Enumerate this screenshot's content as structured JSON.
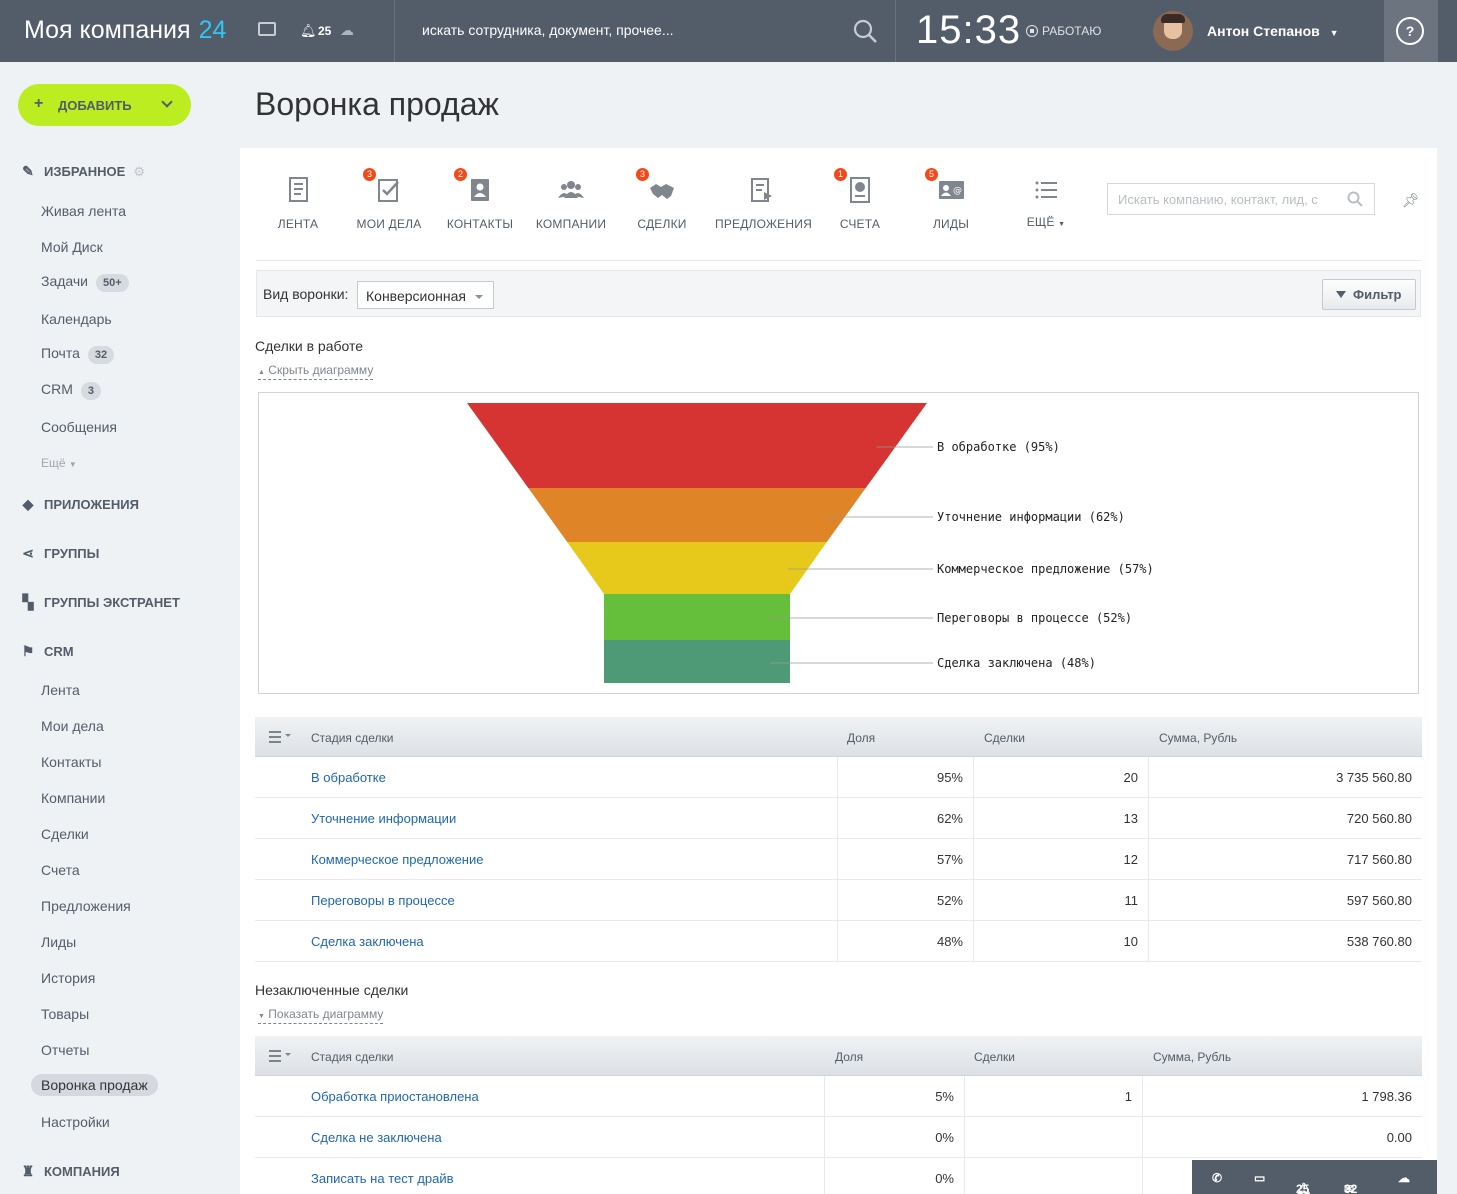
{
  "topbar": {
    "logo_text": "Моя компания",
    "logo_number": "24",
    "notifications_count": "25",
    "search_placeholder": "искать сотрудника, документ, прочее...",
    "clock": "15:33",
    "work_status": "РАБОТАЮ",
    "user_name": "Антон Степанов",
    "help_label": "?"
  },
  "sidebar": {
    "add_button": "ДОБАВИТЬ",
    "favorites_label": "ИЗБРАННОЕ",
    "favorites": [
      {
        "label": "Живая лента"
      },
      {
        "label": "Мой Диск"
      },
      {
        "label": "Задачи",
        "badge": "50+"
      },
      {
        "label": "Календарь"
      },
      {
        "label": "Почта",
        "badge": "32"
      },
      {
        "label": "CRM",
        "badge": "3"
      },
      {
        "label": "Сообщения"
      }
    ],
    "more_label": "Ещё",
    "sections": {
      "apps": "ПРИЛОЖЕНИЯ",
      "groups": "ГРУППЫ",
      "extranet": "ГРУППЫ ЭКСТРАНЕТ",
      "crm": "CRM",
      "company": "КОМПАНИЯ"
    },
    "crm_items": [
      {
        "label": "Лента"
      },
      {
        "label": "Мои дела"
      },
      {
        "label": "Контакты"
      },
      {
        "label": "Компании"
      },
      {
        "label": "Сделки"
      },
      {
        "label": "Счета"
      },
      {
        "label": "Предложения"
      },
      {
        "label": "Лиды"
      },
      {
        "label": "История"
      },
      {
        "label": "Товары"
      },
      {
        "label": "Отчеты"
      },
      {
        "label": "Воронка продаж",
        "active": true
      },
      {
        "label": "Настройки"
      }
    ]
  },
  "page_title": "Воронка продаж",
  "crm_nav": [
    {
      "label": "ЛЕНТА",
      "icon": "feed-icon",
      "counter": ""
    },
    {
      "label": "МОИ ДЕЛА",
      "icon": "tasks-icon",
      "counter": "3"
    },
    {
      "label": "КОНТАКТЫ",
      "icon": "contacts-icon",
      "counter": "2"
    },
    {
      "label": "КОМПАНИИ",
      "icon": "companies-icon",
      "counter": ""
    },
    {
      "label": "СДЕЛКИ",
      "icon": "deals-icon",
      "counter": "3"
    },
    {
      "label": "ПРЕДЛОЖЕНИЯ",
      "icon": "quotes-icon",
      "counter": ""
    },
    {
      "label": "СЧЕТА",
      "icon": "invoices-icon",
      "counter": "1"
    },
    {
      "label": "ЛИДЫ",
      "icon": "leads-icon",
      "counter": "5"
    },
    {
      "label": "ЕЩЁ",
      "icon": "more-icon",
      "counter": ""
    }
  ],
  "crm_search_placeholder": "Искать компанию, контакт, лид, с",
  "funnel_view": {
    "label": "Вид воронки:",
    "value": "Конверсионная",
    "filter_label": "Фильтр"
  },
  "deals_in_work": {
    "title": "Сделки в работе",
    "toggle": "Скрыть диаграмму"
  },
  "chart_data": {
    "type": "funnel",
    "stages": [
      {
        "name": "В обработке",
        "percent": 95,
        "label": "В обработке (95%)",
        "color": "#d63333"
      },
      {
        "name": "Уточнение информации",
        "percent": 62,
        "label": "Уточнение информации (62%)",
        "color": "#df8427"
      },
      {
        "name": "Коммерческое предложение",
        "percent": 57,
        "label": "Коммерческое предложение (57%)",
        "color": "#e6c91b"
      },
      {
        "name": "Переговоры в процессе",
        "percent": 52,
        "label": "Переговоры в процессе (52%)",
        "color": "#66bf3a"
      },
      {
        "name": "Сделка заключена",
        "percent": 48,
        "label": "Сделка заключена (48%)",
        "color": "#4f9a76"
      }
    ]
  },
  "table_headers": {
    "stage": "Стадия сделки",
    "share": "Доля",
    "deals": "Сделки",
    "sum": "Сумма, Рубль"
  },
  "table_in_work": [
    {
      "stage": "В обработке",
      "share": "95%",
      "deals": "20",
      "sum": "3 735 560.80"
    },
    {
      "stage": "Уточнение информации",
      "share": "62%",
      "deals": "13",
      "sum": "720 560.80"
    },
    {
      "stage": "Коммерческое предложение",
      "share": "57%",
      "deals": "12",
      "sum": "717 560.80"
    },
    {
      "stage": "Переговоры в процессе",
      "share": "52%",
      "deals": "11",
      "sum": "597 560.80"
    },
    {
      "stage": "Сделка заключена",
      "share": "48%",
      "deals": "10",
      "sum": "538 760.80"
    }
  ],
  "lost_deals": {
    "title": "Незаключенные сделки",
    "toggle": "Показать диаграмму"
  },
  "table_lost": [
    {
      "stage": "Обработка приостановлена",
      "share": "5%",
      "deals": "1",
      "sum": "1 798.36"
    },
    {
      "stage": "Сделка не заключена",
      "share": "0%",
      "deals": "",
      "sum": "0.00"
    },
    {
      "stage": "Записать на тест драйв",
      "share": "0%",
      "deals": "",
      "sum": ""
    }
  ],
  "bottom_bar": {
    "notifications": "25",
    "messages": "32"
  }
}
